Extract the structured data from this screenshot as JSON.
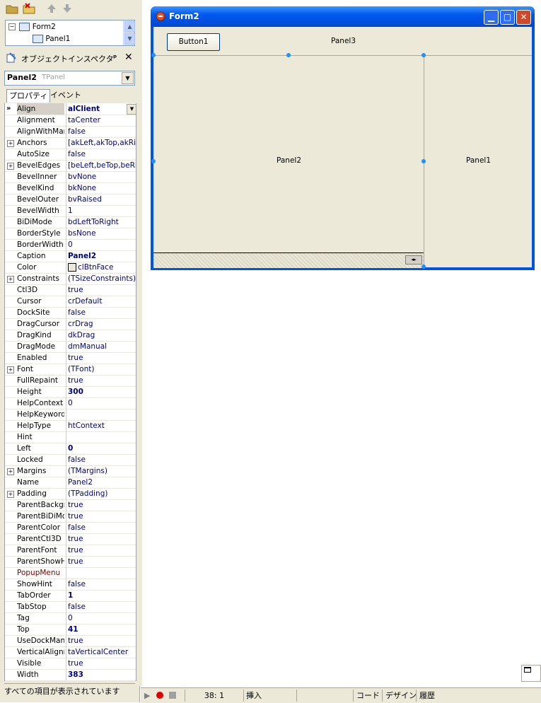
{
  "tree": {
    "items": [
      "Form2",
      "Panel1"
    ]
  },
  "object_inspector": {
    "title": "オブジェクトインスペクタ",
    "pin_glyph": "ᵖ",
    "close_glyph": "✕",
    "selected_object": "Panel2",
    "selected_type": "TPanel",
    "tabs": [
      "プロパティ",
      "イベント"
    ],
    "properties": [
      {
        "name": "Align",
        "value": "alClient",
        "bold": true,
        "selected": true,
        "dropdown": true
      },
      {
        "name": "Alignment",
        "value": "taCenter"
      },
      {
        "name": "AlignWithMargins",
        "value": "false"
      },
      {
        "name": "Anchors",
        "value": "[akLeft,akTop,akRight]",
        "expandable": true
      },
      {
        "name": "AutoSize",
        "value": "false"
      },
      {
        "name": "BevelEdges",
        "value": "[beLeft,beTop,beRight]",
        "expandable": true
      },
      {
        "name": "BevelInner",
        "value": "bvNone"
      },
      {
        "name": "BevelKind",
        "value": "bkNone"
      },
      {
        "name": "BevelOuter",
        "value": "bvRaised"
      },
      {
        "name": "BevelWidth",
        "value": "1"
      },
      {
        "name": "BiDiMode",
        "value": "bdLeftToRight"
      },
      {
        "name": "BorderStyle",
        "value": "bsNone"
      },
      {
        "name": "BorderWidth",
        "value": "0"
      },
      {
        "name": "Caption",
        "value": "Panel2",
        "bold": true
      },
      {
        "name": "Color",
        "value": "clBtnFace",
        "swatch": true
      },
      {
        "name": "Constraints",
        "value": "(TSizeConstraints)",
        "expandable": true
      },
      {
        "name": "Ctl3D",
        "value": "true"
      },
      {
        "name": "Cursor",
        "value": "crDefault"
      },
      {
        "name": "DockSite",
        "value": "false"
      },
      {
        "name": "DragCursor",
        "value": "crDrag"
      },
      {
        "name": "DragKind",
        "value": "dkDrag"
      },
      {
        "name": "DragMode",
        "value": "dmManual"
      },
      {
        "name": "Enabled",
        "value": "true"
      },
      {
        "name": "Font",
        "value": "(TFont)",
        "expandable": true
      },
      {
        "name": "FullRepaint",
        "value": "true"
      },
      {
        "name": "Height",
        "value": "300",
        "bold": true
      },
      {
        "name": "HelpContext",
        "value": "0"
      },
      {
        "name": "HelpKeyword",
        "value": ""
      },
      {
        "name": "HelpType",
        "value": "htContext"
      },
      {
        "name": "Hint",
        "value": ""
      },
      {
        "name": "Left",
        "value": "0",
        "bold": true
      },
      {
        "name": "Locked",
        "value": "false"
      },
      {
        "name": "Margins",
        "value": "(TMargins)",
        "expandable": true
      },
      {
        "name": "Name",
        "value": "Panel2"
      },
      {
        "name": "Padding",
        "value": "(TPadding)",
        "expandable": true
      },
      {
        "name": "ParentBackground",
        "value": "true"
      },
      {
        "name": "ParentBiDiMode",
        "value": "true"
      },
      {
        "name": "ParentColor",
        "value": "false"
      },
      {
        "name": "ParentCtl3D",
        "value": "true"
      },
      {
        "name": "ParentFont",
        "value": "true"
      },
      {
        "name": "ParentShowHint",
        "value": "true"
      },
      {
        "name": "PopupMenu",
        "value": "",
        "red": true
      },
      {
        "name": "ShowHint",
        "value": "false"
      },
      {
        "name": "TabOrder",
        "value": "1",
        "bold": true
      },
      {
        "name": "TabStop",
        "value": "false"
      },
      {
        "name": "Tag",
        "value": "0"
      },
      {
        "name": "Top",
        "value": "41",
        "bold": true
      },
      {
        "name": "UseDockManager",
        "value": "true"
      },
      {
        "name": "VerticalAlignment",
        "value": "taVerticalCenter"
      },
      {
        "name": "Visible",
        "value": "true"
      },
      {
        "name": "Width",
        "value": "383",
        "bold": true
      }
    ],
    "status": "すべての項目が表示されています"
  },
  "form": {
    "title": "Form2",
    "button1": "Button1",
    "panel3": "Panel3",
    "panel2": "Panel2",
    "panel1": "Panel1"
  },
  "bottom": {
    "position": "38:  1",
    "mode": "挿入",
    "tabs": [
      "コード",
      "デザイン",
      "履歴"
    ]
  }
}
